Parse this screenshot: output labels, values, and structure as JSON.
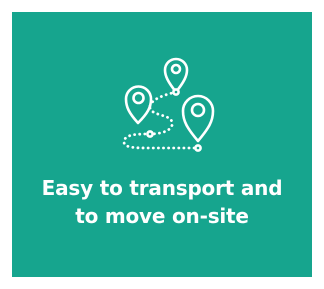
{
  "card": {
    "background_color": "#16a58e",
    "icon": "route-map-pins-icon",
    "headline_line1": "Easy to transport and",
    "headline_line2": "to move on-site"
  }
}
